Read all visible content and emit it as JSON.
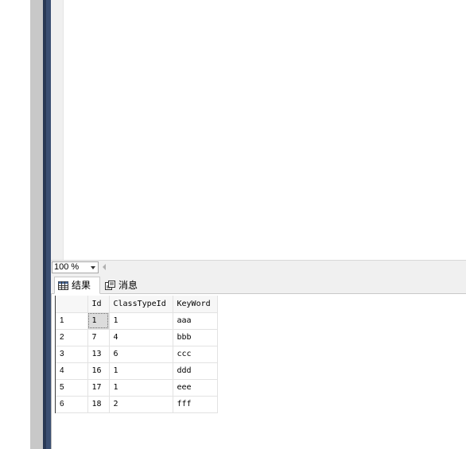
{
  "zoom": {
    "value": "100 %"
  },
  "tabs": [
    {
      "label": "结果",
      "icon": "grid-icon",
      "active": true
    },
    {
      "label": "消息",
      "icon": "messages-icon",
      "active": false
    }
  ],
  "results": {
    "columns": [
      "Id",
      "ClassTypeId",
      "KeyWord"
    ],
    "rows": [
      {
        "num": "1",
        "id": "1",
        "class_type_id": "1",
        "keyword": "aaa"
      },
      {
        "num": "2",
        "id": "7",
        "class_type_id": "4",
        "keyword": "bbb"
      },
      {
        "num": "3",
        "id": "13",
        "class_type_id": "6",
        "keyword": "ccc"
      },
      {
        "num": "4",
        "id": "16",
        "class_type_id": "1",
        "keyword": "ddd"
      },
      {
        "num": "5",
        "id": "17",
        "class_type_id": "1",
        "keyword": "eee"
      },
      {
        "num": "6",
        "id": "18",
        "class_type_id": "2",
        "keyword": "fff"
      }
    ]
  },
  "colors": {
    "navy": "#293955",
    "selection": "#dcdcdc"
  }
}
